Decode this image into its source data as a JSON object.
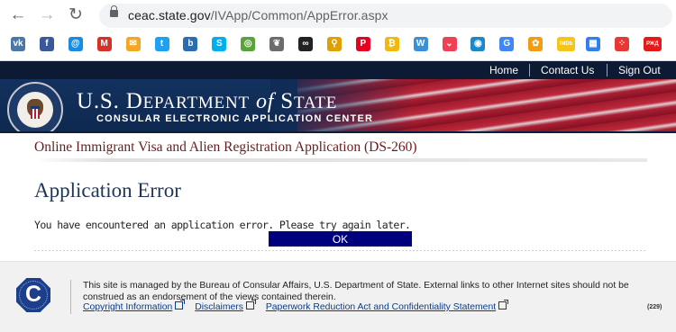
{
  "browser": {
    "url_host": "ceac.state.gov",
    "url_path": "/IVApp/Common/AppError.aspx",
    "nav": {
      "back": "←",
      "forward": "→",
      "reload": "↻"
    },
    "bookmarks": [
      {
        "icon": "vk-icon",
        "glyph": "vk",
        "color": "#4a76a8"
      },
      {
        "icon": "facebook-icon",
        "glyph": "f",
        "color": "#3b5998"
      },
      {
        "icon": "mail-at-icon",
        "glyph": "@",
        "color": "#168de2"
      },
      {
        "icon": "gmail-icon",
        "glyph": "M",
        "color": "#d93025"
      },
      {
        "icon": "envelope-icon",
        "glyph": "✉",
        "color": "#f5a623"
      },
      {
        "icon": "twitter-icon",
        "glyph": "t",
        "color": "#1da1f2"
      },
      {
        "icon": "bookmark-b-icon",
        "glyph": "b",
        "color": "#2a6db0"
      },
      {
        "icon": "skype-icon",
        "glyph": "S",
        "color": "#00aff0"
      },
      {
        "icon": "globe-icon",
        "glyph": "◎",
        "color": "#5aa33a"
      },
      {
        "icon": "leaf-icon",
        "glyph": "❦",
        "color": "#6c6c6c"
      },
      {
        "icon": "infinity-icon",
        "glyph": "∞",
        "color": "#222222"
      },
      {
        "icon": "person-icon",
        "glyph": "⚲",
        "color": "#e0a000"
      },
      {
        "icon": "pinterest-icon",
        "glyph": "P",
        "color": "#e60023"
      },
      {
        "icon": "coin-icon",
        "glyph": "₿",
        "color": "#f0b90b"
      },
      {
        "icon": "wikipedia-icon",
        "glyph": "W",
        "color": "#3a8fd6"
      },
      {
        "icon": "pocket-icon",
        "glyph": "⌄",
        "color": "#ef4056"
      },
      {
        "icon": "target-icon",
        "glyph": "◉",
        "color": "#1e88c7"
      },
      {
        "icon": "translate-icon",
        "glyph": "G",
        "color": "#4285f4"
      },
      {
        "icon": "reel-icon",
        "glyph": "✿",
        "color": "#f39c12"
      },
      {
        "icon": "imdb-icon",
        "glyph": "IMDb",
        "color": "#f5c518"
      },
      {
        "icon": "grid-icon",
        "glyph": "▦",
        "color": "#2f80ed"
      },
      {
        "icon": "dots-icon",
        "glyph": "⁘",
        "color": "#e53935"
      },
      {
        "icon": "rzd-icon",
        "glyph": "РЖД",
        "color": "#e21a1a"
      }
    ]
  },
  "site_nav": {
    "home": "Home",
    "contact": "Contact Us",
    "signout": "Sign Out"
  },
  "banner": {
    "title_main": "U.S. D",
    "title_caps": "EPARTMENT",
    "title_of": "of",
    "title_state_s": "S",
    "title_state": "TATE",
    "subtitle": "CONSULAR ELECTRONIC APPLICATION CENTER"
  },
  "page": {
    "form_title": "Online Immigrant Visa and Alien Registration Application (DS-260)",
    "error_heading": "Application Error",
    "error_message": "You have encountered an application error. Please try again later.",
    "ok_label": "OK"
  },
  "footer": {
    "logo_letter": "C",
    "text": "This site is managed by the Bureau of Consular Affairs, U.S. Department of State. External links to other Internet sites should not be construed as an endorsement of the views contained therein.",
    "links": [
      "Copyright Information",
      "Disclaimers",
      "Paperwork Reduction Act and Confidentiality Statement"
    ],
    "code": "(229)"
  }
}
